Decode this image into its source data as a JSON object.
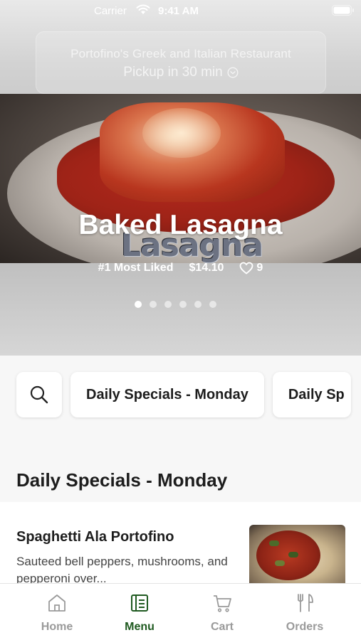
{
  "status_bar": {
    "carrier": "Carrier",
    "time": "9:41 AM"
  },
  "header": {
    "restaurant_name": "Portofino's Greek and Italian Restaurant",
    "pickup_label": "Pickup in 30 min"
  },
  "featured": {
    "photo_watermark": "Lasagna",
    "title": "Baked Lasagna",
    "badge": "#1 Most Liked",
    "price": "$14.10",
    "likes": "9",
    "carousel_count": 6,
    "active_slide": 1
  },
  "categories": {
    "chips": [
      "Daily Specials - Monday",
      "Daily Sp"
    ]
  },
  "section": {
    "title": "Daily Specials - Monday"
  },
  "menu_items": [
    {
      "name": "Spaghetti Ala Portofino",
      "description": "Sauteed bell peppers, mushrooms, and pepperoni over..."
    }
  ],
  "tab_bar": {
    "tabs": [
      {
        "label": "Home",
        "icon": "home-icon"
      },
      {
        "label": "Menu",
        "icon": "menu-icon"
      },
      {
        "label": "Cart",
        "icon": "cart-icon"
      },
      {
        "label": "Orders",
        "icon": "orders-icon"
      }
    ],
    "active_tab": "Menu"
  },
  "colors": {
    "accent": "#1f5a20",
    "inactive": "#9a9a9a"
  }
}
